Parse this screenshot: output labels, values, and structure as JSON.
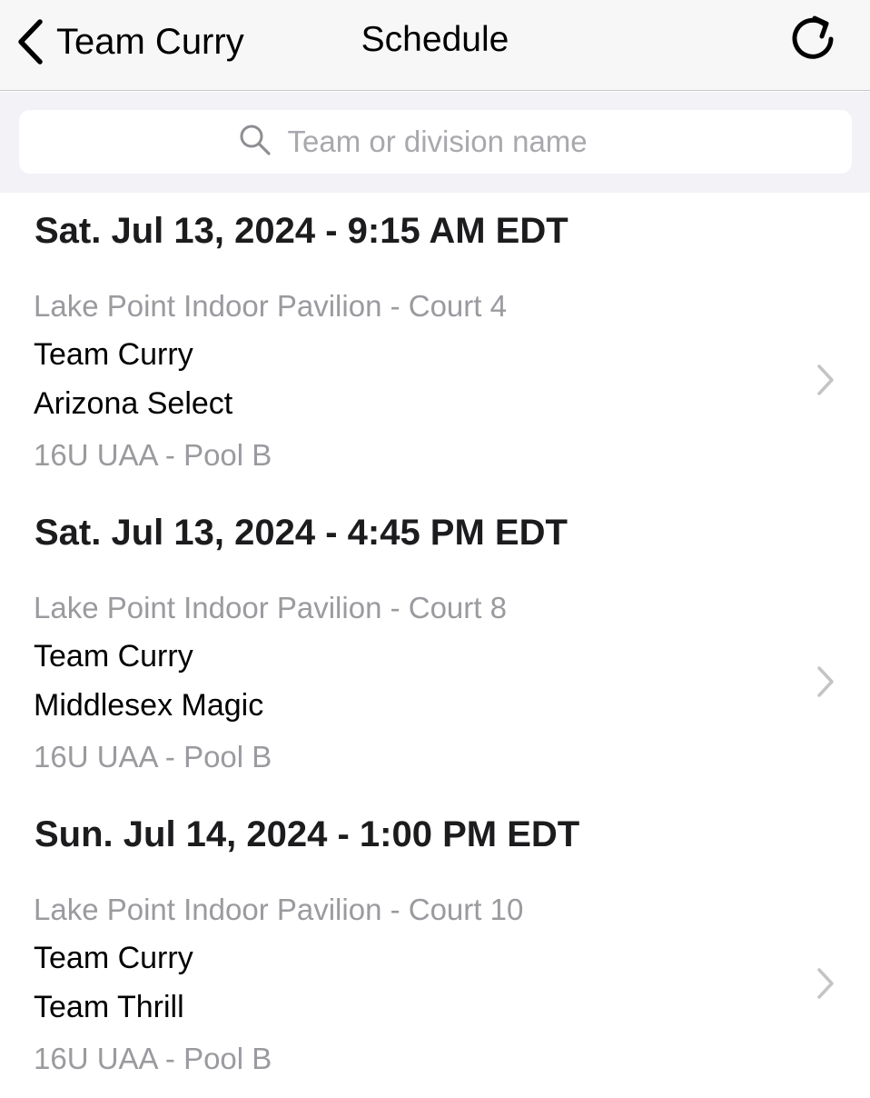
{
  "navbar": {
    "back_label": "Team Curry",
    "title": "Schedule",
    "back_icon": "chevron-left-icon",
    "refresh_icon": "refresh-icon"
  },
  "search": {
    "placeholder": "Team or division name",
    "value": "",
    "icon": "search-icon"
  },
  "games": [
    {
      "datetime": "Sat. Jul 13, 2024 - 9:15 AM EDT",
      "location": "Lake Point Indoor Pavilion - Court 4",
      "team1": "Team Curry",
      "team2": "Arizona Select",
      "division": "16U UAA - Pool B"
    },
    {
      "datetime": "Sat. Jul 13, 2024 - 4:45 PM EDT",
      "location": "Lake Point Indoor Pavilion - Court 8",
      "team1": "Team Curry",
      "team2": "Middlesex Magic",
      "division": "16U UAA - Pool B"
    },
    {
      "datetime": "Sun. Jul 14, 2024 - 1:00 PM EDT",
      "location": "Lake Point Indoor Pavilion - Court 10",
      "team1": "Team Curry",
      "team2": "Team Thrill",
      "division": "16U UAA - Pool B"
    }
  ],
  "colors": {
    "navbar_bg": "#f7f7f7",
    "search_area_bg": "#f2f2f7",
    "secondary_text": "#9a9a9f",
    "chevron": "#c4c4c7"
  }
}
